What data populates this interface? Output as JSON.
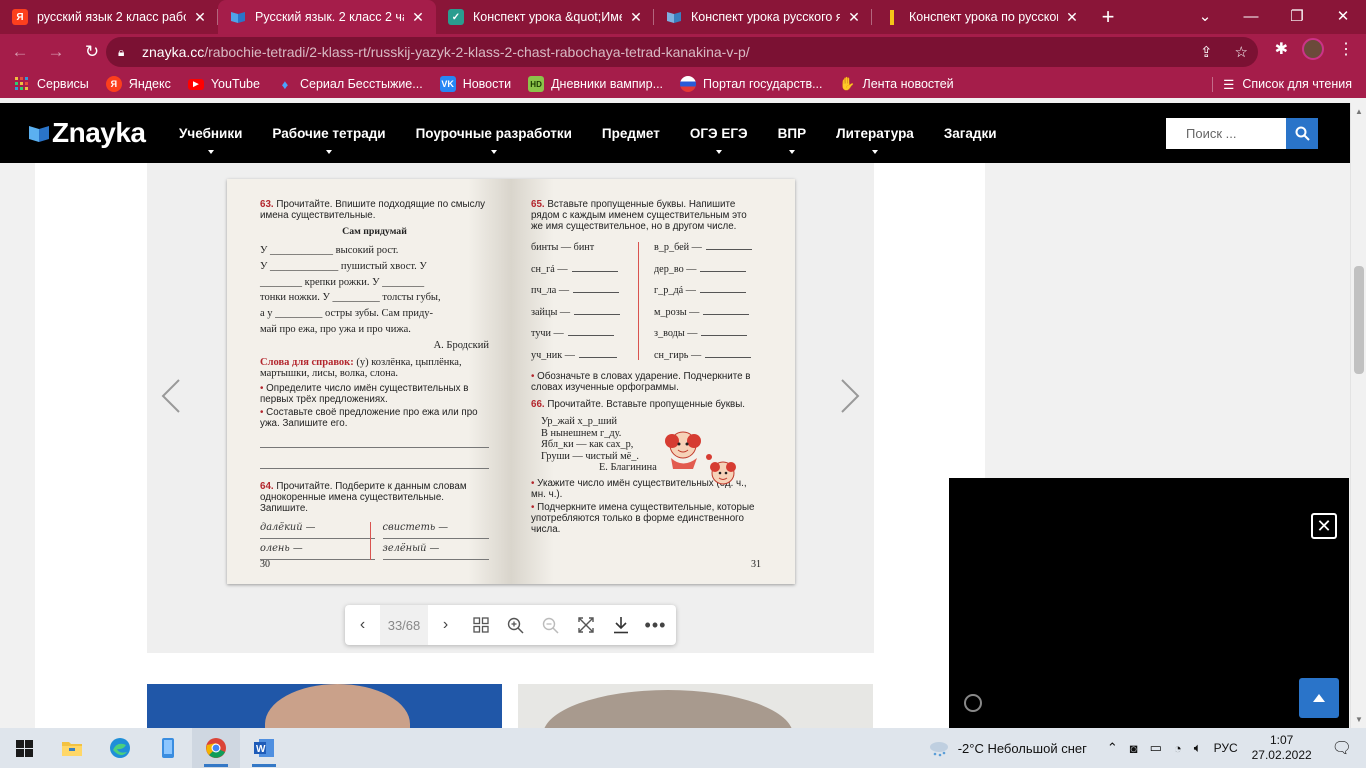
{
  "browser": {
    "tabs": [
      {
        "title": "русский язык 2 класс рабоч",
        "icon": "yandex-icon",
        "active": false
      },
      {
        "title": "Русский язык. 2 класс 2 час",
        "icon": "znayka-icon",
        "active": true
      },
      {
        "title": "Конспект урока &quot;Имен",
        "icon": "check-icon",
        "active": false
      },
      {
        "title": "Конспект урока русского яз",
        "icon": "book-icon",
        "active": false
      },
      {
        "title": "Конспект урока по русском",
        "icon": "yellow-bar-icon",
        "active": false
      }
    ],
    "new_tab": "+",
    "url_host": "znayka.cc",
    "url_path": "/rabochie-tetradi/2-klass-rt/russkij-yazyk-2-klass-2-chast-rabochaya-tetrad-kanakina-v-p/",
    "bookmarks": [
      {
        "label": "Сервисы",
        "icon": "apps-grid-icon"
      },
      {
        "label": "Яндекс",
        "icon": "yandex-icon"
      },
      {
        "label": "YouTube",
        "icon": "youtube-icon"
      },
      {
        "label": "Сериал Бесстыжие...",
        "icon": "flame-icon"
      },
      {
        "label": "Новости",
        "icon": "vk-icon"
      },
      {
        "label": "Дневники вампир...",
        "icon": "hd-icon"
      },
      {
        "label": "Портал государств...",
        "icon": "gov-icon"
      },
      {
        "label": "Лента новостей",
        "icon": "news-icon"
      }
    ],
    "reading_list": "Список для чтения",
    "colors": {
      "tab_strip": "#8a1538",
      "toolbar": "#a51d4a"
    }
  },
  "site": {
    "logo": "Znayka",
    "menu": [
      {
        "label": "Учебники",
        "dropdown": true
      },
      {
        "label": "Рабочие тетради",
        "dropdown": true
      },
      {
        "label": "Поурочные разработки",
        "dropdown": true
      },
      {
        "label": "Предмет",
        "dropdown": false
      },
      {
        "label": "ОГЭ ЕГЭ",
        "dropdown": true
      },
      {
        "label": "ВПР",
        "dropdown": true
      },
      {
        "label": "Литература",
        "dropdown": true
      },
      {
        "label": "Загадки",
        "dropdown": false
      }
    ],
    "search_placeholder": "Поиск ...",
    "accent": "#2a74c9"
  },
  "reader": {
    "page_counter": "33/68",
    "left_page": {
      "ex63_num": "63.",
      "ex63_text": "Прочитайте. Впишите подходящие по смыслу имена существительные.",
      "poem_title": "Сам придумай",
      "poem_l1": "У ____________ высокий рост.",
      "poem_l2": "У _____________ пушистый хвост. У",
      "poem_l3": "________ крепки рожки. У ________",
      "poem_l4": "тонки ножки. У _________ толсты губы,",
      "poem_l5": "а у _________ остры зубы. Сам приду-",
      "poem_l6": "май про ежа, про ужа и про чижа.",
      "author": "А. Бродский",
      "hint_label": "Слова для справок:",
      "hint_text": "(у) козлёнка, цыплёнка, мартышки, лисы, волка, слона.",
      "task1": "Определите число имён существительных в первых трёх предложениях.",
      "task2": "Составьте своё предложение про ежа или про ужа. Запишите его.",
      "ex64_num": "64.",
      "ex64_text": "Прочитайте. Подберите к данным словам однокоренные имена существительные. Запишите.",
      "hw1": "далёкий —",
      "hw2": "свистеть —",
      "hw3": "олень —",
      "hw4": "зелёный —",
      "page_no": "30"
    },
    "right_page": {
      "ex65_num": "65.",
      "ex65_text": "Вставьте пропущенные буквы. Напишите рядом с каждым именем существительным это же имя существительное, но в другом числе.",
      "left_col": [
        "бинты — бинт",
        "сн_гá —",
        "пч_ла —",
        "зайцы —",
        "тучи —",
        "уч_ник —"
      ],
      "right_col": [
        "в_р_бей —",
        "дер_во —",
        "г_р_дá —",
        "м_розы —",
        "з_воды —",
        "сн_гирь —"
      ],
      "task1": "Обозначьте в словах ударение. Подчеркните в словах изученные орфограммы.",
      "ex66_num": "66.",
      "ex66_text": "Прочитайте. Вставьте пропущенные буквы.",
      "poem_l1": "Ур_жай х_р_ший",
      "poem_l2": "В нынешнем г_ду.",
      "poem_l3": "Ябл_ки — как сах_р,",
      "poem_l4": "Груши — чистый мё_.",
      "author": "Е. Благинина",
      "task2": "Укажите число имён существительных (ед. ч., мн. ч.).",
      "task3": "Подчеркните имена существительные, которые употребляются только в форме единственного числа.",
      "page_no": "31"
    }
  },
  "taskbar": {
    "weather": "-2°C  Небольшой снег",
    "lang": "РУС",
    "time": "1:07",
    "date": "27.02.2022"
  }
}
